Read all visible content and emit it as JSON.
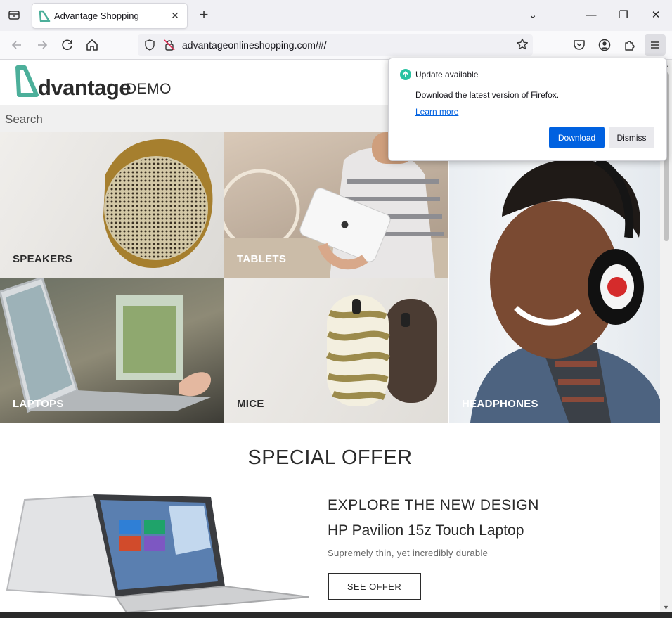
{
  "browser": {
    "tab": {
      "title": "Advantage Shopping",
      "close_glyph": "✕"
    },
    "new_tab_glyph": "+",
    "url": "advantageonlineshopping.com/#/",
    "window_controls": {
      "tabs_menu": "⌄",
      "minimize": "—",
      "restore": "❐",
      "close": "✕"
    },
    "icons": [
      "tab-list-icon",
      "back-icon",
      "forward-icon",
      "reload-icon",
      "home-icon",
      "shield-icon",
      "lock-warning-icon",
      "bookmark-star-icon",
      "pocket-icon",
      "account-icon",
      "extensions-icon",
      "menu-icon"
    ]
  },
  "update_popup": {
    "title": "Update available",
    "description": "Download the latest version of Firefox.",
    "learn_more": "Learn more",
    "download": "Download",
    "dismiss": "Dismiss"
  },
  "site": {
    "logo_main": "dvantage",
    "logo_demo": "DEMO",
    "search_label": "Search",
    "categories": {
      "speakers": "SPEAKERS",
      "tablets": "TABLETS",
      "headphones": "HEADPHONES",
      "laptops": "LAPTOPS",
      "mice": "MICE"
    },
    "special_offer": {
      "title": "SPECIAL OFFER",
      "heading": "EXPLORE THE NEW DESIGN",
      "product": "HP Pavilion 15z Touch Laptop",
      "tagline": "Supremely thin, yet incredibly durable",
      "button": "SEE OFFER"
    }
  },
  "colors": {
    "accent": "#0061e0",
    "brand_teal": "#4caf9a",
    "update_green": "#2ac3a2"
  }
}
